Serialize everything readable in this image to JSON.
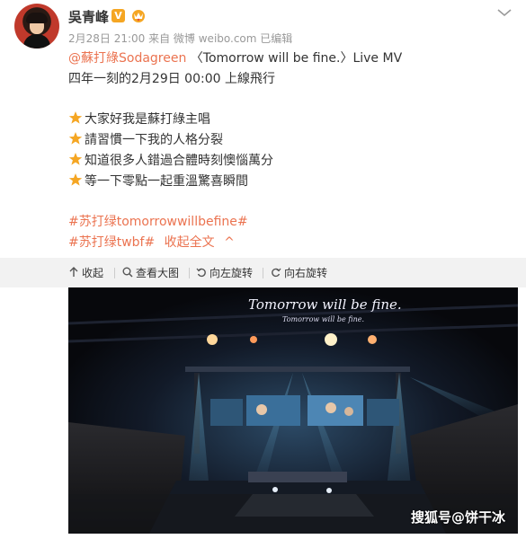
{
  "post": {
    "author": "吳青峰",
    "meta": "2月28日 21:00 来自 微博 weibo.com  已编辑",
    "lines": {
      "l1_mention": "@蘇打綠Sodagreen",
      "l1_rest": " 〈Tomorrow will be fine.〉Live MV",
      "l2": "四年一刻的2月29日 00:00 上線飛行",
      "l4": "大家好我是蘇打綠主唱",
      "l5": "請習慣一下我的人格分裂",
      "l6": "知道很多人錯過合體時刻懊惱萬分",
      "l7": "等一下零點一起重溫驚喜瞬間",
      "tag1": "#苏打绿tomorrowwillbefine#",
      "tag2": "#苏打绿twbf#",
      "collapse": "收起全文",
      "collapse_arrow": "^"
    }
  },
  "toolbar": {
    "collapse": "收起",
    "view_large": "查看大图",
    "rotate_left": "向左旋转",
    "rotate_right": "向右旋转"
  },
  "image": {
    "neon_line1": "Tomorrow will be fine.",
    "neon_line2": "Tomorrow will be fine.",
    "watermark": "搜狐号@饼干冰"
  },
  "colors": {
    "link": "#eb7350",
    "star": "#f5a623",
    "badge": "#f5a623"
  },
  "icons": [
    "verified-badge-icon",
    "crown-icon",
    "chevron-down-icon",
    "star-icon",
    "collapse-icon",
    "magnify-icon",
    "rotate-left-icon",
    "rotate-right-icon"
  ]
}
